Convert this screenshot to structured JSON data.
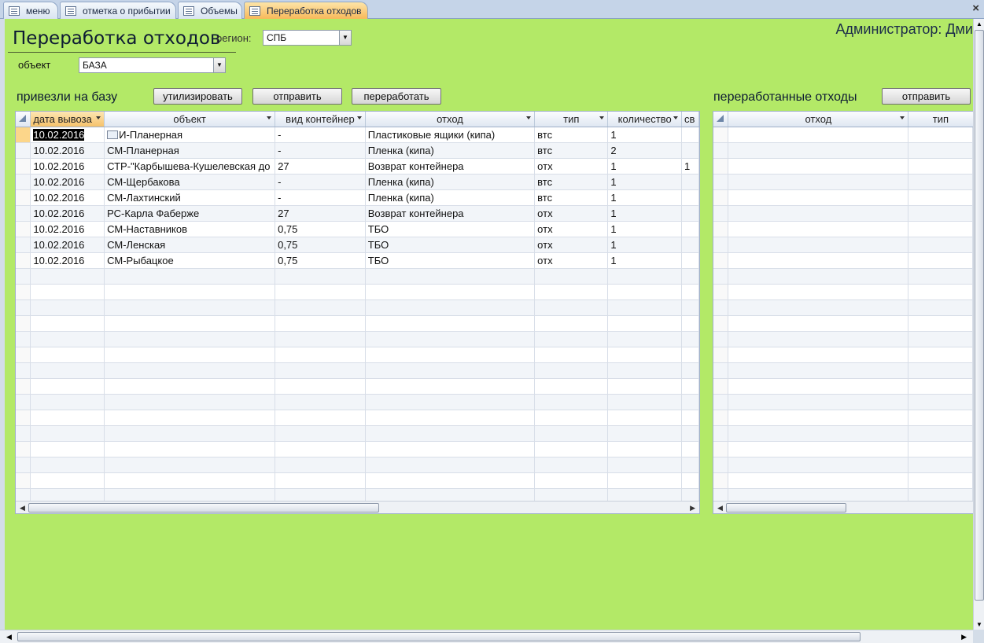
{
  "tabs": [
    {
      "label": "меню"
    },
    {
      "label": "отметка о прибытии"
    },
    {
      "label": "Объемы"
    },
    {
      "label": "Переработка отходов"
    }
  ],
  "form": {
    "title": "Переработка отходов",
    "user": "Администратор: Дми",
    "region_label": "регион:",
    "region_value": "СПБ",
    "object_label": "объект",
    "object_value": "БАЗА",
    "section_left": "привезли на базу",
    "section_right": "переработанные отходы",
    "buttons": {
      "utilize": "утилизировать",
      "send": "отправить",
      "process": "переработать",
      "send_right": "отправить"
    }
  },
  "left_grid": {
    "columns": [
      "дата вывоза",
      "объект",
      "вид контейнер",
      "отход",
      "тип",
      "количество",
      "св"
    ],
    "rows": [
      [
        "10.02.2016",
        "И-Планерная",
        "-",
        "Пластиковые ящики (кипа)",
        "втс",
        "1",
        ""
      ],
      [
        "10.02.2016",
        "СМ-Планерная",
        "-",
        "Пленка (кипа)",
        "втс",
        "2",
        ""
      ],
      [
        "10.02.2016",
        "СТР-\"Карбышева-Кушелевская до",
        "27",
        "Возврат контейнера",
        "отх",
        "1",
        "1"
      ],
      [
        "10.02.2016",
        "СМ-Щербакова",
        "-",
        "Пленка (кипа)",
        "втс",
        "1",
        ""
      ],
      [
        "10.02.2016",
        "СМ-Лахтинский",
        "-",
        "Пленка (кипа)",
        "втс",
        "1",
        ""
      ],
      [
        "10.02.2016",
        "РС-Карла Фаберже",
        "27",
        "Возврат контейнера",
        "отх",
        "1",
        ""
      ],
      [
        "10.02.2016",
        "СМ-Наставников",
        "0,75",
        "ТБО",
        "отх",
        "1",
        ""
      ],
      [
        "10.02.2016",
        "СМ-Ленская",
        "0,75",
        "ТБО",
        "отх",
        "1",
        ""
      ],
      [
        "10.02.2016",
        "СМ-Рыбацкое",
        "0,75",
        "ТБО",
        "отх",
        "1",
        ""
      ]
    ]
  },
  "right_grid": {
    "columns": [
      "отход",
      "тип"
    ]
  },
  "colors": {
    "form_bg": "#b3e967",
    "active_tab": "#f7b95a",
    "selected_cell": "#000000"
  }
}
